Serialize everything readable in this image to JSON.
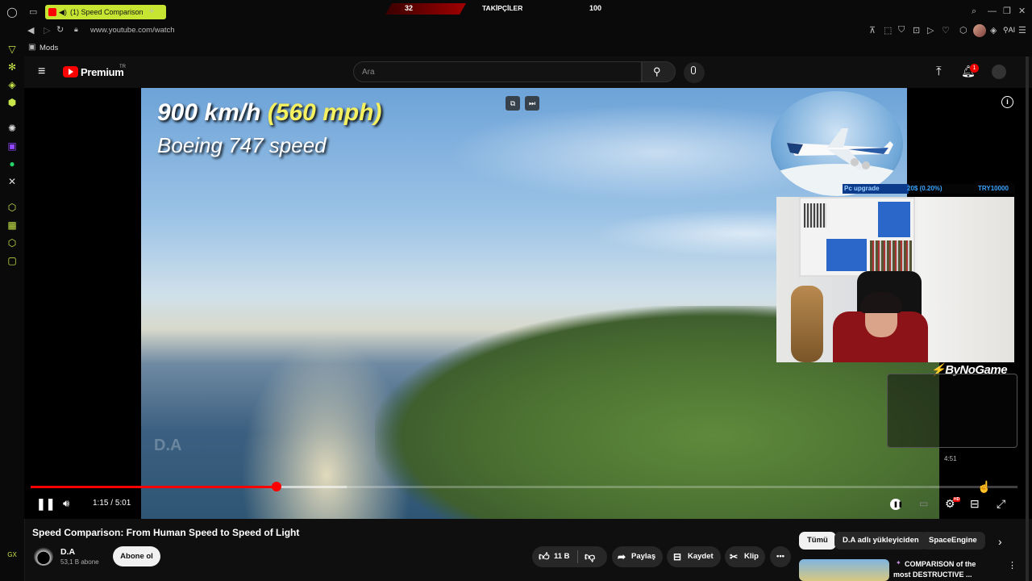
{
  "browser": {
    "tab_title": "(1) Speed Comparison",
    "url": "www.youtube.com/watch",
    "bookmark_label": "Mods",
    "ai_label": "AI",
    "gx_label": "GX"
  },
  "stream_overlay": {
    "follower_current": "32",
    "follower_label": "TAKİPÇİLER",
    "follower_goal": "100",
    "streamer_name": "ByNoGame",
    "donation_goal_label": "Pc upgrade",
    "donation_progress": "20$ (0.20%)",
    "donation_target": "TRY10000",
    "mini_time": "4:51"
  },
  "youtube_header": {
    "logo_text": "Premium",
    "region_badge": "TR",
    "search_placeholder": "Ara",
    "notification_count": "1"
  },
  "video_overlay": {
    "speed_kmh": "900 km/h",
    "speed_mph": "(560 mph)",
    "subtitle": "Boeing 747 speed",
    "watermark": "D.A"
  },
  "player": {
    "current_time": "1:15",
    "separator": " / ",
    "duration": "5:01",
    "played_fraction": 0.249,
    "buffered_fraction": 0.32,
    "settings_badge": "HD"
  },
  "video_info": {
    "title": "Speed Comparison: From Human Speed to Speed of Light",
    "channel_name": "D.A",
    "subscriber_count": "53,1 B abone",
    "subscribe_label": "Abone ol",
    "like_count": "11 B",
    "share_label": "Paylaş",
    "save_label": "Kaydet",
    "clip_label": "Klip"
  },
  "chips": [
    {
      "label": "Tümü"
    },
    {
      "label": "D.A adlı yükleyiciden"
    },
    {
      "label": "SpaceEngine"
    }
  ],
  "recommendation": {
    "title_line1": "COMPARISON of the",
    "title_line2": "most DESTRUCTIVE ..."
  }
}
